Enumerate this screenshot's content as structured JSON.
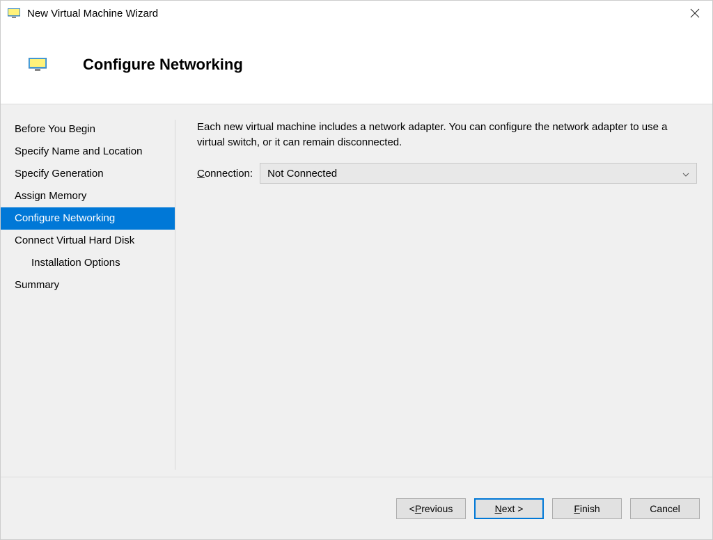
{
  "window": {
    "title": "New Virtual Machine Wizard"
  },
  "header": {
    "title": "Configure Networking"
  },
  "sidebar": {
    "items": [
      {
        "label": "Before You Begin",
        "selected": false,
        "indent": false
      },
      {
        "label": "Specify Name and Location",
        "selected": false,
        "indent": false
      },
      {
        "label": "Specify Generation",
        "selected": false,
        "indent": false
      },
      {
        "label": "Assign Memory",
        "selected": false,
        "indent": false
      },
      {
        "label": "Configure Networking",
        "selected": true,
        "indent": false
      },
      {
        "label": "Connect Virtual Hard Disk",
        "selected": false,
        "indent": false
      },
      {
        "label": "Installation Options",
        "selected": false,
        "indent": true
      },
      {
        "label": "Summary",
        "selected": false,
        "indent": false
      }
    ]
  },
  "content": {
    "instruction": "Each new virtual machine includes a network adapter. You can configure the network adapter to use a virtual switch, or it can remain disconnected.",
    "connection_label_pre": "C",
    "connection_label_post": "onnection:",
    "connection_value": "Not Connected"
  },
  "buttons": {
    "previous_pre": "< ",
    "previous_m": "P",
    "previous_post": "revious",
    "next_m": "N",
    "next_post": "ext >",
    "finish_m": "F",
    "finish_post": "inish",
    "cancel": "Cancel"
  }
}
